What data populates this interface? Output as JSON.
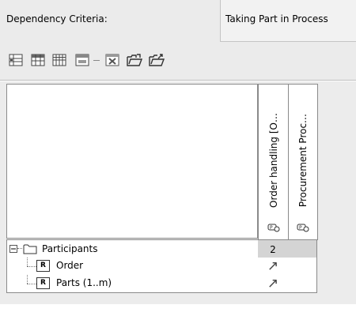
{
  "criteria": {
    "label": "Dependency Criteria:",
    "value": "Taking Part in Process"
  },
  "toolbar": {
    "buttons": [
      "expand-rows-icon",
      "table-icon",
      "grid-icon",
      "dependency-icon",
      "delete-icon",
      "open-folder-icon",
      "export-folder-icon"
    ]
  },
  "matrix": {
    "columns": [
      {
        "label": "Order handling [O…"
      },
      {
        "label": "Procurement Proc…"
      }
    ],
    "rows": [
      {
        "label": "Participants",
        "badge": "",
        "cells": [
          "2",
          ""
        ],
        "type": "package"
      },
      {
        "label": "Order",
        "badge": "R",
        "cells": [
          "↗",
          ""
        ],
        "type": "element"
      },
      {
        "label": "Parts (1..m)",
        "badge": "R",
        "cells": [
          "↗",
          ""
        ],
        "type": "element"
      }
    ]
  }
}
